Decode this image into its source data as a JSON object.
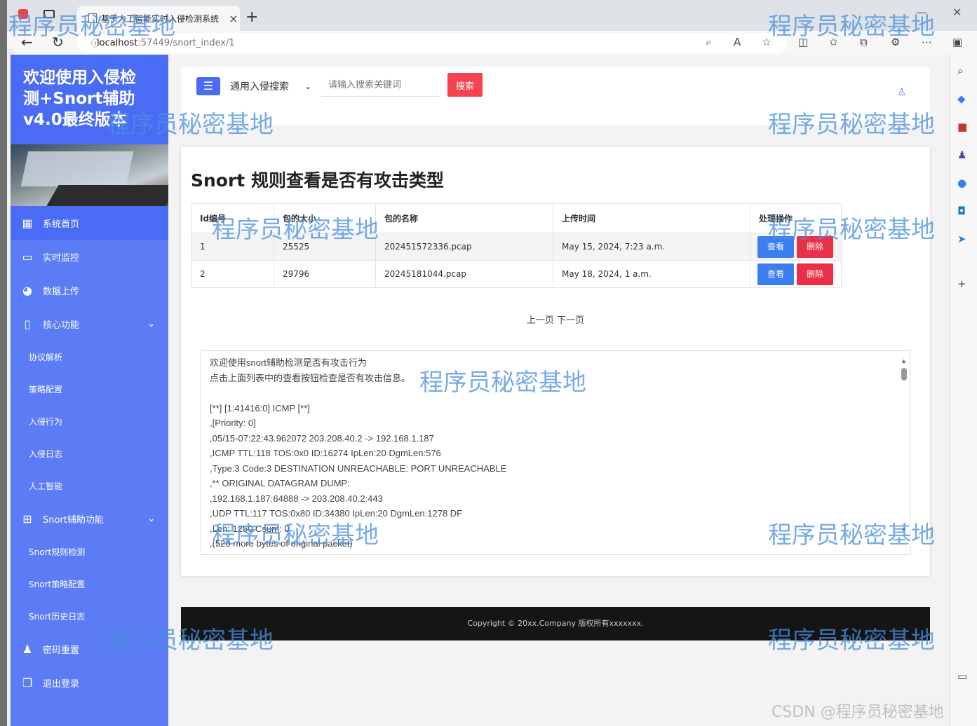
{
  "browser": {
    "tab_title": "基于人工智能实时入侵检测系统",
    "url_host": "localhost",
    "url_port_path": ":57449/snort_index/1",
    "new_tab": "+",
    "close_tab": "×",
    "minimize": "—",
    "close_window": "✕"
  },
  "sidebar": {
    "brand_line1": "欢迎使用入侵检",
    "brand_line2": "测+Snort辅助",
    "brand_line3": "v4.0最终版本",
    "items": [
      {
        "label": "系统首页",
        "icon": "grid-icon"
      },
      {
        "label": "实时监控",
        "icon": "monitor-icon"
      },
      {
        "label": "数据上传",
        "icon": "pie-chart-icon"
      },
      {
        "label": "核心功能",
        "icon": "file-icon"
      }
    ],
    "core_subs": [
      "协议解析",
      "策略配置",
      "入侵行为",
      "入侵日志",
      "人工智能"
    ],
    "snort_group": "Snort辅助功能",
    "snort_subs": [
      "Snort规则检测",
      "Snort策略配置",
      "Snort历史日志"
    ],
    "password_reset": "密码重置",
    "logout": "退出登录"
  },
  "topbar": {
    "menu_toggle": "☰",
    "search_type": "通用入侵搜索",
    "search_placeholder": "请输入搜索关键词",
    "search_button": "搜索"
  },
  "main": {
    "title": "Snort 规则查看是否有攻击类型",
    "table": {
      "headers": [
        "Id编号",
        "包的大小",
        "包的名称",
        "上传时间",
        "处理操作"
      ],
      "rows": [
        {
          "id": "1",
          "size": "25525",
          "name": "202451572336.pcap",
          "time": "May 15, 2024, 7:23 a.m."
        },
        {
          "id": "2",
          "size": "29796",
          "name": "20245181044.pcap",
          "time": "May 18, 2024, 1 a.m."
        }
      ],
      "view_label": "查看",
      "delete_label": "删除"
    },
    "pager": "上一页 下一页",
    "log_lines": [
      "欢迎使用snort辅助检测是否有攻击行为",
      "点击上面列表中的查看按钮检查是否有攻击信息。",
      "",
      "[**] [1:41416:0] ICMP [**]",
      ",[Priority: 0]",
      ",05/15-07:22:43.962072 203.208.40.2 -> 192.168.1.187",
      ",ICMP TTL:118 TOS:0x0 ID:16274 IpLen:20 DgmLen:576",
      ",Type:3  Code:3  DESTINATION UNREACHABLE: PORT UNREACHABLE",
      ",** ORIGINAL DATAGRAM DUMP:",
      ",192.168.1.187:64888 -> 203.208.40.2:443",
      ",UDP TTL:117 TOS:0x80 ID:34380 IpLen:20 DgmLen:1278 DF",
      ",Len: 1250  Csum: 0",
      ",(520 more bytes of original packet)"
    ]
  },
  "footer": {
    "copyright": "Copyright © 20xx.Company 版权所有xxxxxxx."
  },
  "watermark": {
    "text": "程序员秘密基地",
    "csdn": "CSDN @程序员秘密基地"
  }
}
